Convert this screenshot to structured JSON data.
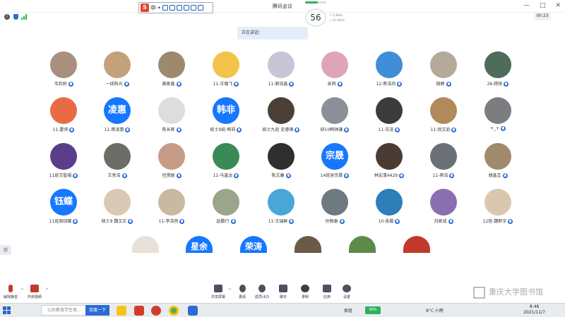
{
  "window": {
    "title": "腾讯会议",
    "controls": [
      "—",
      "□",
      "✕"
    ]
  },
  "ime": {
    "mode": "中",
    "punct": "•"
  },
  "network": {
    "percent": "56",
    "up": "↑ 0.4kb/s",
    "down": "↓ 23.3kb/s"
  },
  "timer": "00:23",
  "speaking": "正在讲话：",
  "participants": [
    {
      "name": "韦欣妍",
      "kind": "photo",
      "bg": "#a98f7d"
    },
    {
      "name": "一线阳光",
      "kind": "photo",
      "bg": "#c4a07c"
    },
    {
      "name": "黄家鑫",
      "kind": "photo",
      "bg": "#9d8a6e"
    },
    {
      "name": "11-王璐飞",
      "kind": "photo",
      "bg": "#f2c24a"
    },
    {
      "name": "11-郭浩鑫",
      "kind": "photo",
      "bg": "#c9c4d6"
    },
    {
      "name": "吴鸽",
      "kind": "photo",
      "bg": "#e0a4b8"
    },
    {
      "name": "12-焦浩冉",
      "kind": "photo",
      "bg": "#3f8ed8"
    },
    {
      "name": "田野",
      "kind": "photo",
      "bg": "#b5a99a"
    },
    {
      "name": "26-杨锐",
      "kind": "photo",
      "bg": "#4f6b5a"
    },
    {
      "name": "11-霍帅",
      "kind": "photo",
      "bg": "#e86b45"
    },
    {
      "name": "11-蒋凌惠",
      "kind": "text",
      "text": "凌惠"
    },
    {
      "name": "陈长辉",
      "kind": "photo",
      "bg": "#dddddd"
    },
    {
      "name": "统士9班-韩非",
      "kind": "text",
      "text": "韩非"
    },
    {
      "name": "统士九班 史睿锋",
      "kind": "photo",
      "bg": "#4a4035"
    },
    {
      "name": "研10韩钟谦",
      "kind": "photo",
      "bg": "#8a8f98"
    },
    {
      "name": "11-甘进",
      "kind": "photo",
      "bg": "#3b3b3b"
    },
    {
      "name": "11-倪文凯",
      "kind": "photo",
      "bg": "#b08a5b"
    },
    {
      "name": "+_+",
      "kind": "photo",
      "bg": "#7c7d80"
    },
    {
      "name": "11班王智福",
      "kind": "photo",
      "bg": "#5b3d8a"
    },
    {
      "name": "王亮浩",
      "kind": "photo",
      "bg": "#6a6e66"
    },
    {
      "name": "任黛妮",
      "kind": "photo",
      "bg": "#c79c87"
    },
    {
      "name": "11-马鑫龙",
      "kind": "photo",
      "bg": "#3a8a55"
    },
    {
      "name": "陈文康",
      "kind": "photo",
      "bg": "#2f2f2f"
    },
    {
      "name": "14班吴宗晟",
      "kind": "text",
      "text": "宗晟"
    },
    {
      "name": "林宏清4429",
      "kind": "photo",
      "bg": "#4a3c32"
    },
    {
      "name": "11-蒋浩",
      "kind": "photo",
      "bg": "#6b6f78"
    },
    {
      "name": "胡鑫芸",
      "kind": "photo",
      "bg": "#a08a6c"
    },
    {
      "name": "11班周钰蝶",
      "kind": "text",
      "text": "钰蝶"
    },
    {
      "name": "硕士9 魏文正",
      "kind": "photo",
      "bg": "#d8c8b4"
    },
    {
      "name": "11-李浩然",
      "kind": "photo",
      "bg": "#c8b9a0"
    },
    {
      "name": "赵鹏行",
      "kind": "photo",
      "bg": "#9aa58a"
    },
    {
      "name": "11-王瑞群",
      "kind": "photo",
      "bg": "#48a7d6"
    },
    {
      "name": "孙慨泰",
      "kind": "photo",
      "bg": "#6e7a80"
    },
    {
      "name": "10-张晨",
      "kind": "photo",
      "bg": "#2c7fb8"
    },
    {
      "name": "刘家成",
      "kind": "photo",
      "bg": "#8a6fb0"
    },
    {
      "name": "12班-魏新宇",
      "kind": "photo",
      "bg": "#d9c7b0"
    }
  ],
  "partial_row": [
    {
      "kind": "photo",
      "bg": "#e8e0d6"
    },
    {
      "kind": "text",
      "text": "星余"
    },
    {
      "kind": "text",
      "text": "荣涛"
    },
    {
      "kind": "photo",
      "bg": "#6b5a45"
    },
    {
      "kind": "photo",
      "bg": "#5c8a4a"
    },
    {
      "kind": "photo",
      "bg": "#c0392b"
    }
  ],
  "toolbar": {
    "mute": "解除静音",
    "video": "开启视频",
    "share": "共享屏幕",
    "invite": "邀请",
    "members": "成员(42)",
    "chat": "聊天",
    "record": "录制",
    "apps": "应用",
    "settings": "设置"
  },
  "taskbar": {
    "search_placeholder": "公民教育学生每...",
    "search_button": "百度一下",
    "tray_user": "家庭",
    "battery": "99%",
    "weather": "8°C 小雨",
    "time": "8:46",
    "date": "2021/11/7"
  },
  "watermark": "重庆大学图书馆"
}
